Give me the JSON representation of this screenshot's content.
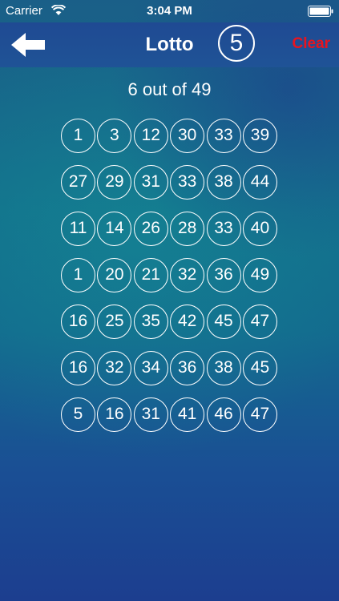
{
  "status_bar": {
    "carrier": "Carrier",
    "time": "3:04 PM"
  },
  "nav": {
    "title": "Lotto",
    "count": "5",
    "clear_label": "Clear",
    "back_icon": "arrow-left-icon"
  },
  "colors": {
    "clear": "#e8141f",
    "nav_background": "#1f4a93"
  },
  "subtitle": "6 out of 49",
  "rows": [
    [
      "1",
      "3",
      "12",
      "30",
      "33",
      "39"
    ],
    [
      "27",
      "29",
      "31",
      "33",
      "38",
      "44"
    ],
    [
      "11",
      "14",
      "26",
      "28",
      "33",
      "40"
    ],
    [
      "1",
      "20",
      "21",
      "32",
      "36",
      "49"
    ],
    [
      "16",
      "25",
      "35",
      "42",
      "45",
      "47"
    ],
    [
      "16",
      "32",
      "34",
      "36",
      "38",
      "45"
    ],
    [
      "5",
      "16",
      "31",
      "41",
      "46",
      "47"
    ]
  ]
}
